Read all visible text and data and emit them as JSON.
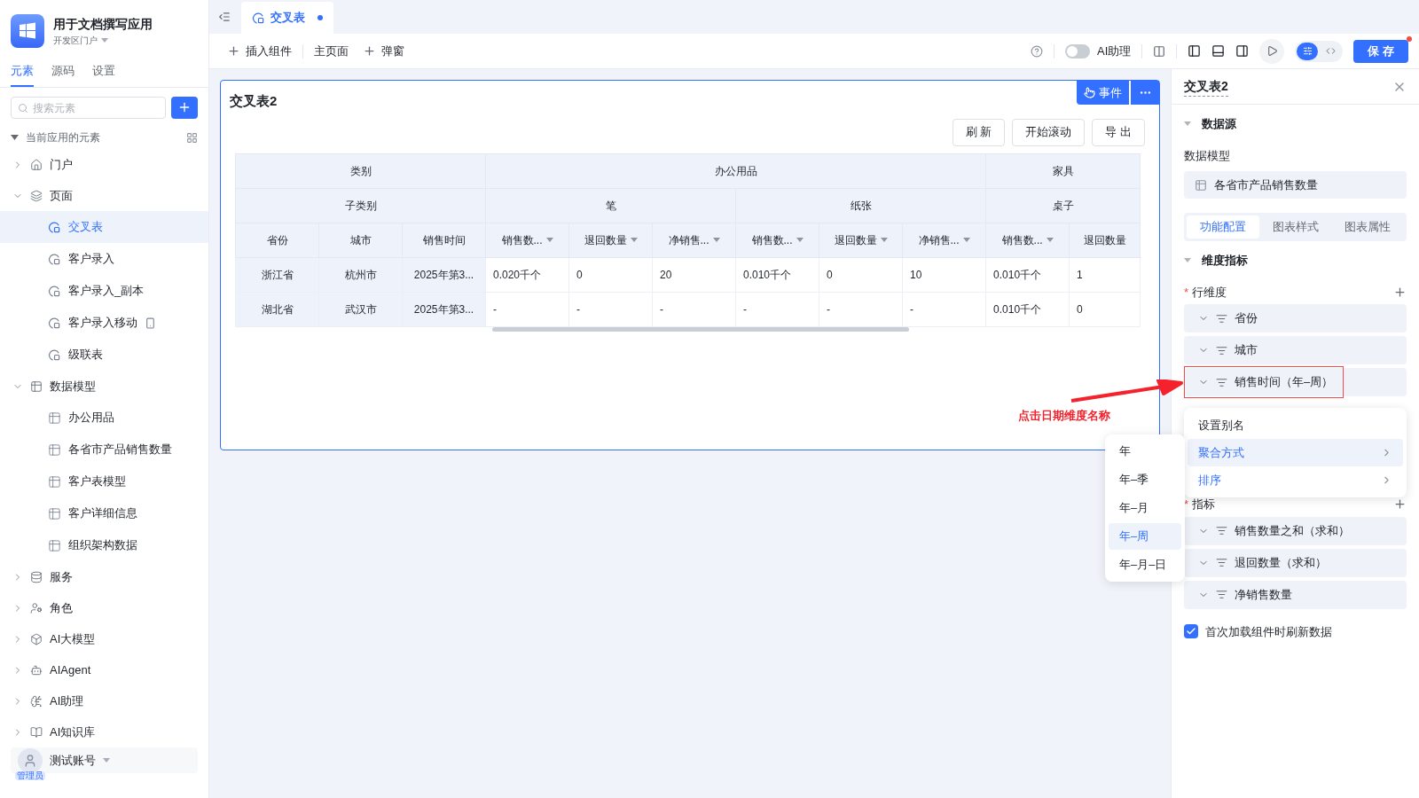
{
  "app": {
    "name": "用于文档撰写应用",
    "portal": "开发区门户"
  },
  "sidebar_tabs": [
    {
      "label": "元素",
      "selected": true
    },
    {
      "label": "源码",
      "selected": false
    },
    {
      "label": "设置",
      "selected": false
    }
  ],
  "search": {
    "placeholder": "搜索元素"
  },
  "tree": {
    "label": "当前应用的元素",
    "expanded": true,
    "children": [
      {
        "label": "门户",
        "kind": "portal",
        "expanded": false,
        "selected": false
      },
      {
        "label": "页面",
        "kind": "pages",
        "expanded": true,
        "selected": false,
        "children": [
          {
            "label": "交叉表",
            "kind": "page",
            "selected": true
          },
          {
            "label": "客户录入",
            "kind": "page",
            "selected": false
          },
          {
            "label": "客户录入_副本",
            "kind": "page",
            "selected": false
          },
          {
            "label": "客户录入移动",
            "kind": "mobile",
            "selected": false
          },
          {
            "label": "级联表",
            "kind": "page",
            "selected": false
          }
        ]
      },
      {
        "label": "数据模型",
        "kind": "models",
        "expanded": true,
        "selected": false,
        "children": [
          {
            "label": "办公用品",
            "kind": "model",
            "selected": false
          },
          {
            "label": "各省市产品销售数量",
            "kind": "model",
            "selected": false
          },
          {
            "label": "客户表模型",
            "kind": "model",
            "selected": false
          },
          {
            "label": "客户详细信息",
            "kind": "model",
            "selected": false
          },
          {
            "label": "组织架构数据",
            "kind": "model",
            "selected": false
          }
        ]
      },
      {
        "label": "服务",
        "kind": "service",
        "expanded": false,
        "selected": false
      },
      {
        "label": "角色",
        "kind": "role",
        "expanded": false,
        "selected": false
      },
      {
        "label": "AI大模型",
        "kind": "llm",
        "expanded": false,
        "selected": false
      },
      {
        "label": "AIAgent",
        "kind": "agent",
        "expanded": false,
        "selected": false
      },
      {
        "label": "AI助理",
        "kind": "assistant",
        "expanded": false,
        "selected": false
      },
      {
        "label": "AI知识库",
        "kind": "knowledge",
        "expanded": false,
        "selected": false
      }
    ]
  },
  "user": {
    "name": "测试账号",
    "role": "管理员"
  },
  "editor_tabs": [
    {
      "label": "交叉表",
      "selected": true,
      "unsaved": true
    }
  ],
  "toolbar": {
    "items": [
      {
        "label": "插入组件",
        "kind": "add"
      },
      {
        "label": "主页面",
        "kind": "plain"
      },
      {
        "label": "弹窗",
        "kind": "add"
      }
    ],
    "assistant": {
      "label": "AI助理",
      "on": false
    },
    "modes": [
      {
        "selected": true
      },
      {
        "selected": false
      }
    ],
    "save": "保 存",
    "unsaved": true
  },
  "card": {
    "title": "交叉表2",
    "event_button": "事件",
    "actions": [
      "刷 新",
      "开始滚动",
      "导 出"
    ],
    "table": {
      "category_heading": "类别",
      "subcategory_heading": "子类别",
      "row_fields": [
        "省份",
        "城市",
        "销售时间"
      ],
      "categories": [
        {
          "label": "办公用品",
          "subcategories": [
            {
              "label": "笔",
              "measures": [
                {
                  "label": "销售数...",
                  "sortable": true
                },
                {
                  "label": "退回数量",
                  "sortable": true
                },
                {
                  "label": "净销售...",
                  "sortable": true
                }
              ]
            },
            {
              "label": "纸张",
              "measures": [
                {
                  "label": "销售数...",
                  "sortable": true
                },
                {
                  "label": "退回数量",
                  "sortable": true
                },
                {
                  "label": "净销售...",
                  "sortable": true
                }
              ]
            }
          ]
        },
        {
          "label": "家具",
          "subcategories": [
            {
              "label": "桌子",
              "measures": [
                {
                  "label": "销售数...",
                  "sortable": true
                },
                {
                  "label": "退回数量",
                  "sortable": false
                }
              ]
            }
          ]
        }
      ],
      "rows": [
        [
          "浙江省",
          "杭州市",
          "2025年第3...",
          "0.020千个",
          "0",
          "20",
          "0.010千个",
          "0",
          "10",
          "0.010千个",
          "1"
        ],
        [
          "湖北省",
          "武汉市",
          "2025年第3...",
          "-",
          "-",
          "-",
          "-",
          "-",
          "-",
          "0.010千个",
          "0"
        ]
      ]
    }
  },
  "annotation": "点击日期维度名称",
  "granularity_menu": [
    {
      "label": "年",
      "selected": false
    },
    {
      "label": "年–季",
      "selected": false
    },
    {
      "label": "年–月",
      "selected": false
    },
    {
      "label": "年–周",
      "selected": true
    },
    {
      "label": "年–月–日",
      "selected": false
    }
  ],
  "panel": {
    "title": "交叉表2",
    "data_source": {
      "heading": "数据源",
      "expanded": true,
      "model_label": "数据模型",
      "model": "各省市产品销售数量"
    },
    "tabs": [
      {
        "label": "功能配置",
        "selected": true
      },
      {
        "label": "图表样式",
        "selected": false
      },
      {
        "label": "图表属性",
        "selected": false
      }
    ],
    "dimensions": {
      "heading": "维度指标",
      "expanded": true,
      "row_label": "行维度",
      "required": true,
      "required_mark": "*",
      "rows": [
        {
          "label": "省份",
          "highlighted": false
        },
        {
          "label": "城市",
          "highlighted": false
        },
        {
          "label": "销售时间（年–周）",
          "highlighted": true
        }
      ],
      "context_menu": [
        {
          "label": "设置别名",
          "kind": "plain",
          "selected": false
        },
        {
          "label": "聚合方式",
          "kind": "submenu",
          "selected": true
        },
        {
          "label": "排序",
          "kind": "submenu",
          "selected": false
        }
      ],
      "metrics_label": "指标",
      "metrics_required": true,
      "metrics": [
        {
          "label": "销售数量之和（求和）"
        },
        {
          "label": "退回数量（求和）"
        },
        {
          "label": "净销售数量"
        }
      ]
    },
    "refresh_on_load": {
      "label": "首次加载组件时刷新数据",
      "checked": true
    }
  }
}
